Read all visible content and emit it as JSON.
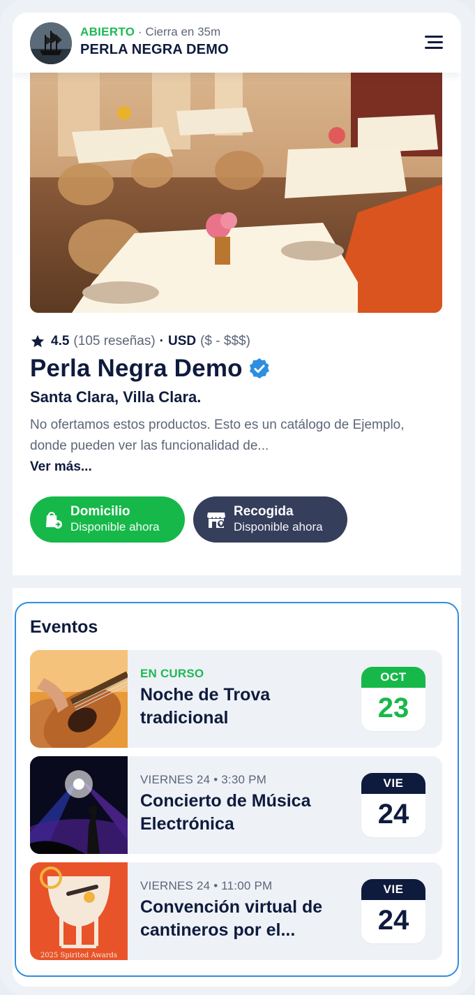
{
  "header": {
    "status": "ABIERTO",
    "separator": "·",
    "closes": "Cierra en 35m",
    "brand": "PERLA NEGRA DEMO"
  },
  "business": {
    "rating": "4.5",
    "reviews": "(105 reseñas)",
    "dot": "·",
    "currency": "USD",
    "price_range": "($ - $$$)",
    "name": "Perla Negra Demo",
    "location": "Santa Clara, Villa Clara.",
    "description": "No ofertamos estos productos. Esto es un catálogo de Ejemplo, donde pueden ver las funcionalidad de...",
    "more_label": "Ver más..."
  },
  "services": [
    {
      "title": "Domicilio",
      "subtitle": "Disponible ahora",
      "icon": "delivery-bag-icon",
      "color": "#16b84a"
    },
    {
      "title": "Recogida",
      "subtitle": "Disponible ahora",
      "icon": "store-pickup-icon",
      "color": "#353f5c"
    }
  ],
  "events": {
    "title": "Eventos",
    "items": [
      {
        "meta": "EN CURSO",
        "title": "Noche de Trova tradicional",
        "cal_head": "OCT",
        "cal_day": "23",
        "cal_color": "#16b84a",
        "image": "guitar-photo"
      },
      {
        "meta": "VIERNES 24 • 3:30 PM",
        "title": "Concierto de Música Electrónica",
        "cal_head": "VIE",
        "cal_day": "24",
        "cal_color": "#0f1b3d",
        "image": "concert-photo"
      },
      {
        "meta": "VIERNES 24 • 11:00 PM",
        "title": "Convención virtual de cantineros por el...",
        "cal_head": "VIE",
        "cal_day": "24",
        "cal_color": "#0f1b3d",
        "image": "spirited-awards-poster",
        "poster_caption": "2025 Spirited Awards"
      }
    ]
  },
  "colors": {
    "accent_green": "#16b84a",
    "navy": "#0f1b3d",
    "link_blue": "#2e8ee0"
  }
}
